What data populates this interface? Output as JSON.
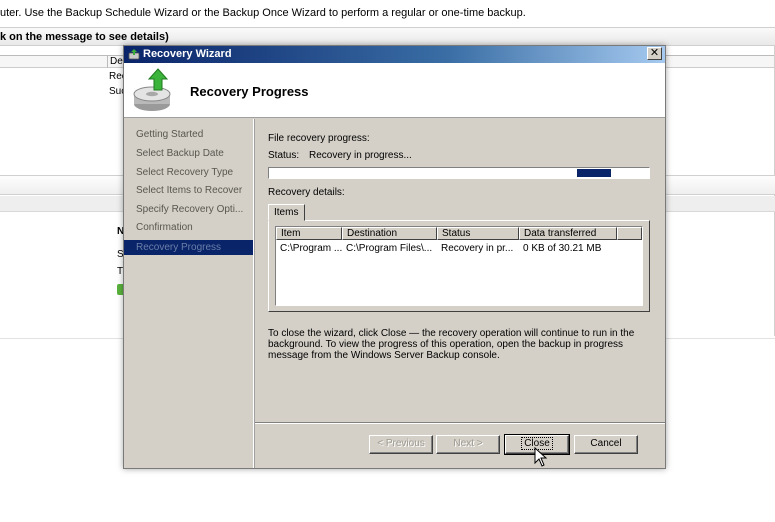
{
  "background": {
    "description_text": "uter. Use the Backup Schedule Wizard or the Backup Once Wizard to perform a regular or one-time backup.",
    "messages_bar": "k on the message to see details)",
    "table_header_col": "De",
    "row1_text": "Rec",
    "row2_text": "Suc",
    "frag_n": "N",
    "frag_s": "S",
    "frag_t": "T"
  },
  "dialog": {
    "title": "Recovery Wizard",
    "close_glyph": "✕",
    "header_title": "Recovery Progress"
  },
  "nav": {
    "items": [
      {
        "label": "Getting Started"
      },
      {
        "label": "Select Backup Date"
      },
      {
        "label": "Select Recovery Type"
      },
      {
        "label": "Select Items to Recover"
      },
      {
        "label": "Specify Recovery Opti..."
      },
      {
        "label": "Confirmation"
      },
      {
        "label": "Recovery Progress"
      }
    ],
    "active_index": 6
  },
  "content": {
    "file_progress_label": "File recovery progress:",
    "status_label": "Status:",
    "status_value": "Recovery in progress...",
    "progress": {
      "fill_start_fraction": 0.81,
      "fill_width_fraction": 0.09
    },
    "details_label": "Recovery details:",
    "tab_label": "Items",
    "columns": [
      "Item",
      "Destination",
      "Status",
      "Data transferred"
    ],
    "rows": [
      [
        "C:\\Program ...",
        "C:\\Program Files\\...",
        "Recovery in pr...",
        "0 KB of 30.21 MB"
      ]
    ],
    "note": "To close the wizard, click Close — the recovery operation will continue to run in the background. To view the progress of this operation, open the backup in progress message from the Windows Server Backup console."
  },
  "buttons": {
    "previous": "< Previous",
    "next": "Next >",
    "close": "Close",
    "cancel": "Cancel"
  },
  "colors": {
    "selection": "#0a246a",
    "dialog_face": "#d4d0c8",
    "title_gradient_start": "#0a246a",
    "title_gradient_end": "#a6caf0"
  }
}
